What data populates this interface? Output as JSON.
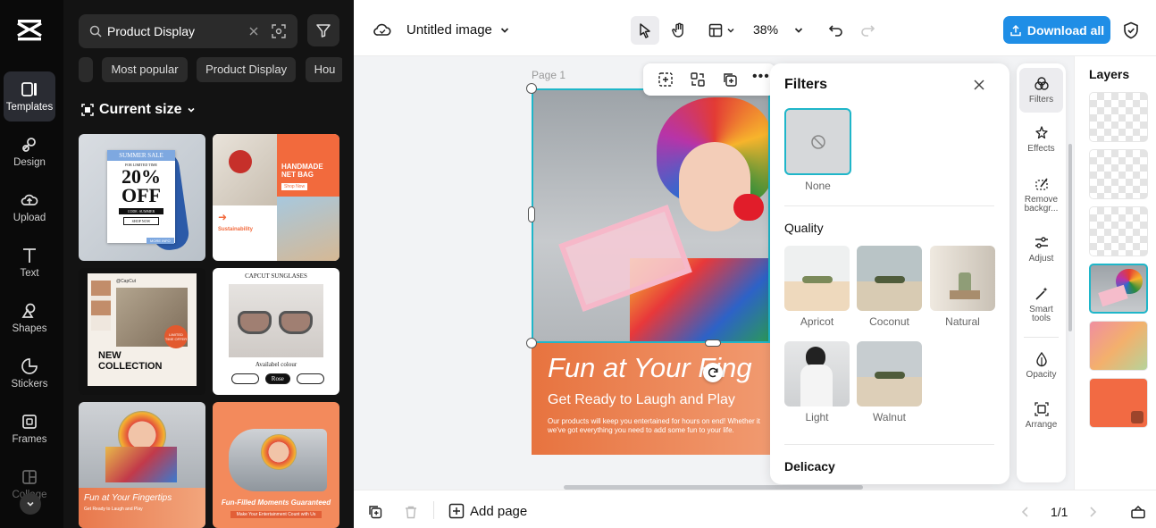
{
  "rail": {
    "items": [
      {
        "label": "Templates",
        "icon": "templates-icon"
      },
      {
        "label": "Design",
        "icon": "design-icon"
      },
      {
        "label": "Upload",
        "icon": "upload-icon"
      },
      {
        "label": "Text",
        "icon": "text-icon"
      },
      {
        "label": "Shapes",
        "icon": "shapes-icon"
      },
      {
        "label": "Stickers",
        "icon": "stickers-icon"
      },
      {
        "label": "Frames",
        "icon": "frames-icon"
      },
      {
        "label": "Collage",
        "icon": "collage-icon"
      }
    ]
  },
  "panel": {
    "search_value": "Product Display",
    "chips": [
      "Most popular",
      "Product Display",
      "Hou"
    ],
    "section_title": "Current size",
    "templates": {
      "t1": {
        "title": "SUMMER SALE",
        "sub": "FOR LIMITED TIME",
        "big": "20%",
        "big2": "OFF",
        "code": "CODE: SUMMER",
        "shop": "SHOP NOW",
        "more": "MORE INFO"
      },
      "t2": {
        "title1": "HANDMADE",
        "title2": "NET BAG",
        "shop": "Shop Now",
        "section": "Sustainability"
      },
      "t3": {
        "brand": "@CapCut",
        "badge": "LIMITED TIME OFFER",
        "title1": "NEW",
        "title2": "COLLECTION"
      },
      "t4": {
        "title": "CAPCUT SUNGLASES",
        "avail": "Availabel colour",
        "opts": [
          "Black",
          "Rose",
          "Silver"
        ]
      },
      "t5": {
        "title": "Fun at Your Fingertips",
        "sub": "Get Ready to Laugh and Play"
      },
      "t6": {
        "title": "Fun-Filled Moments Guaranteed",
        "sub": "Make Your Entertainment Count with Us"
      }
    }
  },
  "topbar": {
    "doc_title": "Untitled image",
    "zoom": "38%",
    "download_label": "Download all"
  },
  "canvas": {
    "page_label": "Page 1",
    "headline": "Fun at Your Fing",
    "subhead": "Get Ready to Laugh and Play",
    "body1": "Our products will keep you entertained for hours on end! Whether it",
    "body2": "we've got everything you need to add some fun to your life."
  },
  "filters": {
    "title": "Filters",
    "none_label": "None",
    "quality_title": "Quality",
    "items": [
      "Apricot",
      "Coconut",
      "Natural",
      "Light",
      "Walnut"
    ],
    "delicacy_title": "Delicacy"
  },
  "tools": {
    "items": [
      {
        "label": "Filters",
        "icon": "filters-icon"
      },
      {
        "label": "Effects",
        "icon": "effects-icon"
      },
      {
        "label": "Remove backgr...",
        "icon": "remove-bg-icon"
      },
      {
        "label": "Adjust",
        "icon": "adjust-icon"
      },
      {
        "label": "Smart tools",
        "icon": "smart-tools-icon"
      },
      {
        "label": "Opacity",
        "icon": "opacity-icon"
      },
      {
        "label": "Arrange",
        "icon": "arrange-icon"
      }
    ]
  },
  "layers": {
    "title": "Layers"
  },
  "bottombar": {
    "add_page": "Add page",
    "page_count": "1/1"
  },
  "colors": {
    "accent": "#1f8ee6",
    "selection": "#1fb6c9",
    "orange": "#f07a4e"
  }
}
